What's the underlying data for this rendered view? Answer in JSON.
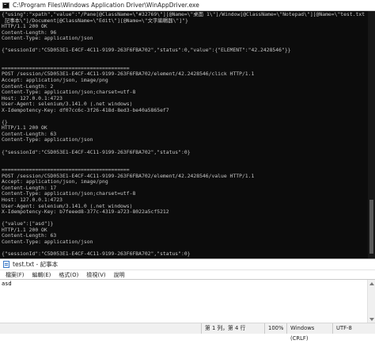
{
  "console": {
    "title": "C:\\Program Files\\Windows Application Driver\\WinAppDriver.exe",
    "lines": [
      "{\"using\":\"xpath\",\"value\":\"/Pane[@ClassName=\\\"#32769\\\"][@Name=\\\"桌面 1\\\"]/Window[@ClassName=\\\"Notepad\\\"][@Name=\\\"test.txt -",
      " 記事本\\\"]/Document[@ClassName=\\\"Edit\\\"][@Name=\\\"文字編輯器\\\"]\"}",
      "HTTP/1.1 200 OK",
      "Content-Length: 96",
      "Content-Type: application/json",
      "",
      "{\"sessionId\":\"C5D053E1-E4CF-4C11-9199-263F6FBA702\",\"status\":0,\"value\":{\"ELEMENT\":\"42.2428546\"}}",
      "",
      "",
      "==========================================",
      "POST /session/C5D053E1-E4CF-4C11-9199-263F6FBA702/element/42.2428546/click HTTP/1.1",
      "Accept: application/json, image/png",
      "Content-Length: 2",
      "Content-Type: application/json;charset=utf-8",
      "Host: 127.0.0.1:4723",
      "User-Agent: selenium/3.141.0 (.net windows)",
      "X-Idempotency-Key: df07cc6c-3f26-418d-8ed3-be40a5865ef7",
      "",
      "{}",
      "HTTP/1.1 200 OK",
      "Content-Length: 63",
      "Content-Type: application/json",
      "",
      "{\"sessionId\":\"C5D053E1-E4CF-4C11-9199-263F6FBA702\",\"status\":0}",
      "",
      "",
      "==========================================",
      "POST /session/C5D053E1-E4CF-4C11-9199-263F6FBA702/element/42.2428546/value HTTP/1.1",
      "Accept: application/json, image/png",
      "Content-Length: 17",
      "Content-Type: application/json;charset=utf-8",
      "Host: 127.0.0.1:4723",
      "User-Agent: selenium/3.141.0 (.net windows)",
      "X-Idempotency-Key: b7feeed8-377c-4319-a723-8022a5cf5212",
      "",
      "{\"value\":[\"asd\"]}",
      "HTTP/1.1 200 OK",
      "Content-Length: 63",
      "Content-Type: application/json",
      "",
      "{\"sessionId\":\"C5D053E1-E4CF-4C11-9199-263F6FBA702\",\"status\":0}"
    ]
  },
  "notepad": {
    "title": "test.txt - 記事本",
    "menu": [
      "檔案(F)",
      "編輯(E)",
      "格式(O)",
      "檢視(V)",
      "說明"
    ],
    "content": "asd",
    "status": {
      "position": "第 1 列，第 4 行",
      "zoom": "100%",
      "line_ending": "Windows (CRLF)",
      "encoding": "UTF-8"
    }
  }
}
